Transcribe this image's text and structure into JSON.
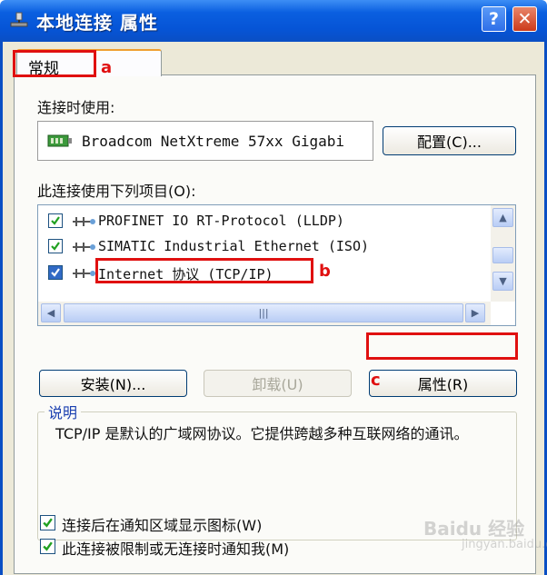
{
  "window": {
    "title": "本地连接 属性",
    "help_label": "?",
    "close_label": "✕"
  },
  "tabs": [
    {
      "label": "常规",
      "selected": true
    }
  ],
  "annotations": {
    "a": "a",
    "b": "b",
    "c": "c"
  },
  "connect_using": {
    "label": "连接时使用:",
    "adapter": "Broadcom NetXtreme 57xx Gigabi",
    "configure_button": "配置(C)..."
  },
  "items_section": {
    "label": "此连接使用下列项目(O):",
    "items": [
      {
        "text": "PROFINET IO RT-Protocol (LLDP)",
        "checked": true
      },
      {
        "text": "SIMATIC Industrial Ethernet (ISO)",
        "checked": true
      },
      {
        "text": "Internet 协议 (TCP/IP)",
        "checked": true,
        "selected": true
      }
    ]
  },
  "buttons": {
    "install": "安装(N)...",
    "uninstall": "卸载(U)",
    "properties": "属性(R)"
  },
  "description": {
    "title": "说明",
    "text": "TCP/IP 是默认的广域网协议。它提供跨越多种互联网络的通讯。"
  },
  "options": [
    {
      "label": "连接后在通知区域显示图标(W)",
      "checked": true
    },
    {
      "label": "此连接被限制或无连接时通知我(M)",
      "checked": true
    }
  ],
  "watermark": {
    "text": "Baidu 经验",
    "sub": "jingyan.baidu.com"
  },
  "colors": {
    "highlight_red": "#e01010",
    "titlebar_blue": "#0654d6",
    "dialog_bg": "#ece9d8"
  }
}
